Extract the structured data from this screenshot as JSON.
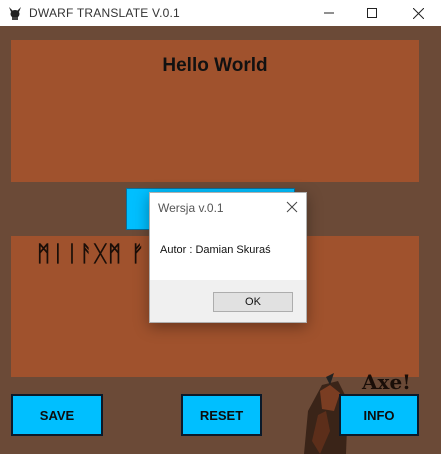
{
  "window": {
    "title": "DWARF TRANSLATE    V.0.1",
    "icon": "horned-helmet-icon"
  },
  "input_panel": {
    "text": "Hello World",
    "color": "#a0522d"
  },
  "output_panel": {
    "runes": "ᛗᛁᛁᚨᚷᛗ ᚠ          ᛒᚨᚠᚱ",
    "color": "#a0522d"
  },
  "buttons": {
    "save": "SAVE",
    "reset": "RESET",
    "info": "INFO",
    "accent": "#00bfff"
  },
  "art": {
    "caption": "Axe!"
  },
  "dialog": {
    "title": "Wersja v.0.1",
    "message": "Autor : Damian Skuraś",
    "ok": "OK"
  },
  "colors": {
    "background": "#6b4a37",
    "panel": "#a0522d",
    "button": "#00bfff"
  }
}
